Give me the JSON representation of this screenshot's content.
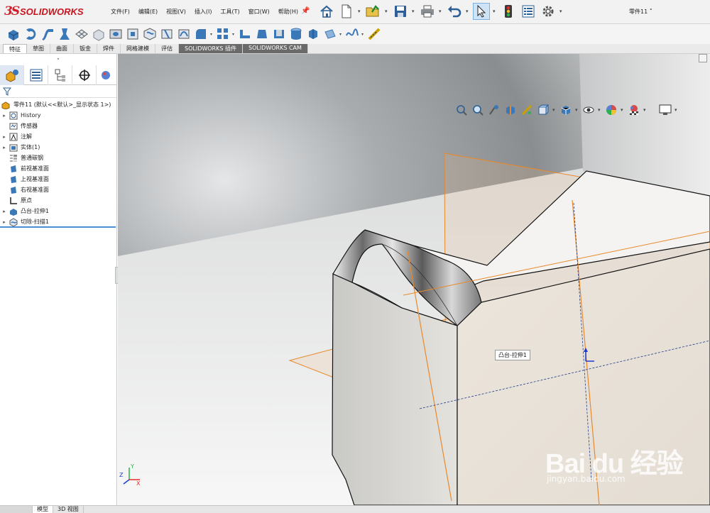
{
  "app": {
    "brand": "SOLIDWORKS",
    "logo_mark": "3S",
    "document": "零件11 ˚"
  },
  "menu": [
    "文件(F)",
    "编辑(E)",
    "视图(V)",
    "插入(I)",
    "工具(T)",
    "窗口(W)",
    "帮助(H)"
  ],
  "quick_toolbar": [
    "home-icon",
    "new-document-icon",
    "open-icon",
    "save-icon",
    "print-icon",
    "undo-icon",
    "select-icon",
    "rebuild-icon",
    "file-properties-icon",
    "options-icon"
  ],
  "command_icons": [
    "extruded-boss-icon",
    "revolved-boss-icon",
    "swept-boss-icon",
    "lofted-boss-icon",
    "boundary-boss-icon",
    "extruded-cut-icon",
    "hole-wizard-icon",
    "revolved-cut-icon",
    "swept-cut-icon",
    "lofted-cut-icon",
    "boundary-cut-icon",
    "fillet-icon",
    "linear-pattern-icon",
    "rib-icon",
    "draft-icon",
    "shell-icon",
    "wrap-icon",
    "intersect-icon",
    "reference-geometry-icon",
    "curves-icon",
    "instant3d-icon"
  ],
  "tabs": [
    {
      "label": "特征",
      "active": true
    },
    {
      "label": "草图"
    },
    {
      "label": "曲面"
    },
    {
      "label": "钣金"
    },
    {
      "label": "焊件"
    },
    {
      "label": "网格建模"
    },
    {
      "label": "评估"
    },
    {
      "label": "SOLIDWORKS 插件",
      "dark": true
    },
    {
      "label": "SOLIDWORKS CAM",
      "dark": true
    }
  ],
  "panel": {
    "grip": "•",
    "tabs": [
      "feature-manager-icon",
      "property-manager-icon",
      "configuration-manager-icon",
      "dimxpert-icon"
    ],
    "root": "零件11  (默认<<默认>_显示状态 1>)",
    "tree": [
      {
        "label": "History",
        "icon": "history-icon",
        "expand": true
      },
      {
        "label": "传感器",
        "icon": "sensor-icon",
        "expand": false
      },
      {
        "label": "注解",
        "icon": "annotation-icon",
        "expand": true
      },
      {
        "label": "实体(1)",
        "icon": "solid-body-icon",
        "expand": true
      },
      {
        "label": "普通碳钢",
        "icon": "material-icon",
        "expand": false
      },
      {
        "label": "前视基准面",
        "icon": "plane-icon",
        "expand": false
      },
      {
        "label": "上视基准面",
        "icon": "plane-icon",
        "expand": false
      },
      {
        "label": "右视基准面",
        "icon": "plane-icon",
        "expand": false
      },
      {
        "label": "原点",
        "icon": "origin-icon",
        "expand": false
      },
      {
        "label": "凸台-拉伸1",
        "icon": "extrude-icon",
        "expand": true
      },
      {
        "label": "切除-扫描1",
        "icon": "sweep-cut-icon",
        "expand": true
      }
    ]
  },
  "viewport": {
    "tooltip": "凸台-拉伸1",
    "triad": {
      "x": "X",
      "y": "Y",
      "z": "Z"
    },
    "hud_icons": [
      "zoom-to-fit-icon",
      "zoom-area-icon",
      "previous-view-icon",
      "section-view-icon",
      "dynamic-annotation-icon",
      "view-orientation-icon",
      "display-style-icon",
      "hide-show-icon",
      "edit-appearance-icon",
      "apply-scene-icon",
      "view-settings-icon"
    ]
  },
  "bottom_tabs": [
    {
      "label": "",
      "active": false
    },
    {
      "label": "模型",
      "active": true
    },
    {
      "label": "3D 视图",
      "active": false
    }
  ],
  "watermark": {
    "text": "Bai du 经验",
    "url": "jingyan.baidu.com"
  },
  "colors": {
    "accent": "#2a5d9f",
    "selection": "#e8892c",
    "brand": "#c8141e"
  }
}
